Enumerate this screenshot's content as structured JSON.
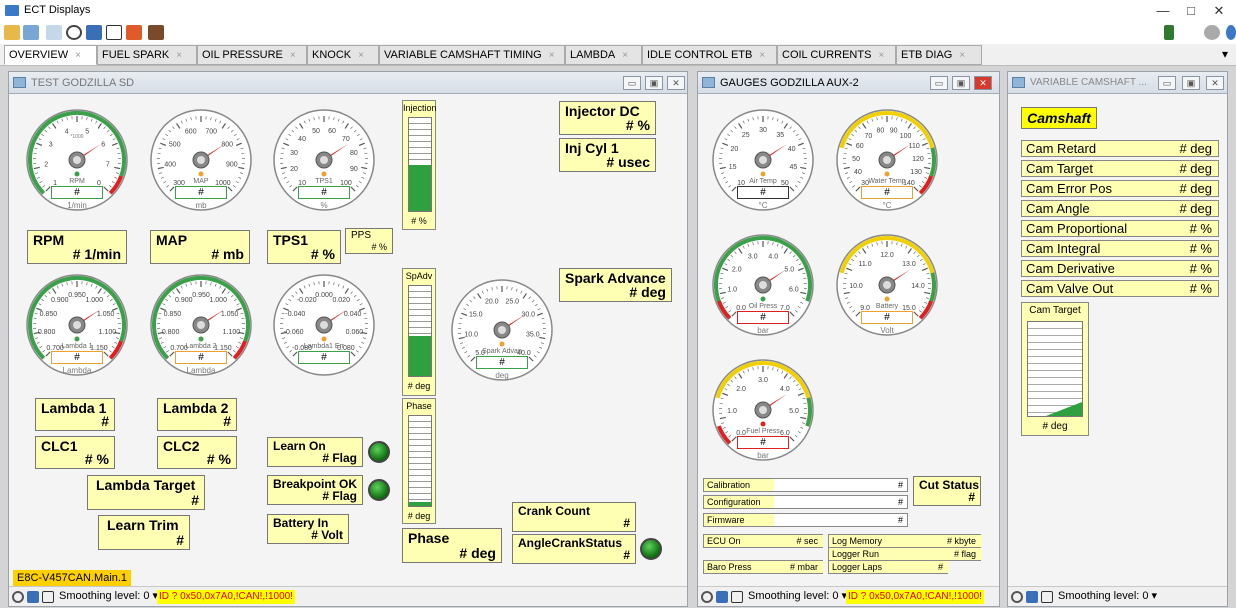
{
  "window": {
    "title": "ECT Displays",
    "min": "—",
    "max": "□",
    "close": "✕"
  },
  "toolbar": {
    "icons": [
      "open-folder-icon",
      "window-icon",
      "cursor-icon",
      "timer-icon",
      "book-icon",
      "export-icon",
      "lock-icon",
      "binoculars-icon"
    ],
    "right_icons": [
      "traffic-light-icon",
      "gear-icon",
      "help-icon"
    ]
  },
  "tabs": [
    {
      "label": "OVERVIEW",
      "x": "×"
    },
    {
      "label": "FUEL SPARK",
      "x": "×"
    },
    {
      "label": "OIL PRESSURE",
      "x": "×"
    },
    {
      "label": "KNOCK",
      "x": "×"
    },
    {
      "label": "VARIABLE CAMSHAFT TIMING",
      "x": "×"
    },
    {
      "label": "LAMBDA",
      "x": "×"
    },
    {
      "label": "IDLE CONTROL ETB",
      "x": "×"
    },
    {
      "label": "COIL CURRENTS",
      "x": "×"
    },
    {
      "label": "ETB DIAG",
      "x": "×"
    }
  ],
  "tab_dropdown": "▾",
  "panel1": {
    "title": "TEST GODZILLA SD",
    "gauges": [
      {
        "name": "RPM",
        "unit": "1/min",
        "value": "#",
        "ticks": [
          "1",
          "2",
          "3",
          "4",
          "5",
          "6",
          "7",
          "0"
        ],
        "mult": "*1000"
      },
      {
        "name": "MAP",
        "unit": "mb",
        "value": "#",
        "ticks": [
          "300",
          "400",
          "500",
          "600",
          "700",
          "800",
          "900",
          "1000"
        ]
      },
      {
        "name": "TPS1",
        "unit": "%",
        "value": "#",
        "ticks": [
          "10",
          "20",
          "30",
          "40",
          "50",
          "60",
          "70",
          "80",
          "90",
          "100"
        ]
      },
      {
        "name": "Lambda 1",
        "unit": "Lambda",
        "value": "#",
        "ticks": [
          "0.700",
          "0.800",
          "0.850",
          "0.900",
          "0.950",
          "1.000",
          "1.050",
          "1.100",
          "1.150"
        ]
      },
      {
        "name": "Lambda 2",
        "unit": "Lambda",
        "value": "#",
        "ticks": [
          "0.700",
          "0.800",
          "0.850",
          "0.900",
          "0.950",
          "1.000",
          "1.050",
          "1.100",
          "1.150"
        ]
      },
      {
        "name": "Lambda1 Err",
        "unit": "",
        "value": "#",
        "ticks": [
          "-0.080",
          "-0.060",
          "-0.040",
          "-0.020",
          "0.000",
          "0.020",
          "0.040",
          "0.060",
          "0.080"
        ]
      },
      {
        "name": "Spark Advan",
        "unit": "deg",
        "value": "#",
        "ticks": [
          "5.0",
          "10.0",
          "15.0",
          "20.0",
          "25.0",
          "30.0",
          "35.0",
          "40.0"
        ]
      }
    ],
    "boxes": {
      "injector_dc": {
        "title": "Injector DC",
        "value": "#  %"
      },
      "inj_cyl1": {
        "title": "Inj Cyl 1",
        "value": "#  usec"
      },
      "rpm": {
        "title": "RPM",
        "value": "#  1/min"
      },
      "map": {
        "title": "MAP",
        "value": "#   mb"
      },
      "tps1": {
        "title": "TPS1",
        "value": "#  %"
      },
      "pps": {
        "title": "PPS",
        "value": "#  %"
      },
      "spark_adv": {
        "title": "Spark Advance",
        "value": "#  deg"
      },
      "lambda1": {
        "title": "Lambda 1",
        "value": "#"
      },
      "lambda2": {
        "title": "Lambda 2",
        "value": "#"
      },
      "clc1": {
        "title": "CLC1",
        "value": "#  %"
      },
      "clc2": {
        "title": "CLC2",
        "value": "#  %"
      },
      "lambda_target": {
        "title": "Lambda Target",
        "value": "#"
      },
      "learn_trim": {
        "title": "Learn Trim",
        "value": "#"
      },
      "learn_on": {
        "title": "Learn On",
        "value": "#  Flag"
      },
      "breakpoint_ok": {
        "title": "Breakpoint OK",
        "value": "#  Flag"
      },
      "battery_in": {
        "title": "Battery In",
        "value": "#  Volt"
      },
      "crank_count": {
        "title": "Crank Count",
        "value": "#"
      },
      "phase": {
        "title": "Phase",
        "value": "#  deg"
      },
      "angle_crank": {
        "title": "AngleCrankStatus",
        "value": "#"
      }
    },
    "bars": [
      {
        "name": "Injection",
        "unit": "# %"
      },
      {
        "name": "SpAdv",
        "unit": "# deg"
      },
      {
        "name": "Phase",
        "unit": "# deg"
      }
    ],
    "footer_label": "E8C-V457CAN.Main.1",
    "status": "Smoothing level: 0 ▾",
    "warning": "ID ? 0x50,0x7A0,!CAN!,!1000!"
  },
  "panel2": {
    "title": "GAUGES GODZILLA AUX-2",
    "gauges": [
      {
        "name": "Air Temp",
        "unit": "°C",
        "value": "#",
        "ticks": [
          "10",
          "15",
          "20",
          "25",
          "30",
          "35",
          "40",
          "45",
          "50"
        ]
      },
      {
        "name": "Water Temp",
        "unit": "°C",
        "value": "#",
        "ticks": [
          "30",
          "40",
          "50",
          "60",
          "70",
          "80",
          "90",
          "100",
          "110",
          "120",
          "130",
          "140"
        ]
      },
      {
        "name": "Oil Press",
        "unit": "bar",
        "value": "#",
        "ticks": [
          "0.0",
          "1.0",
          "2.0",
          "3.0",
          "4.0",
          "5.0",
          "6.0",
          "7.0"
        ]
      },
      {
        "name": "Battery",
        "unit": "Volt",
        "value": "#",
        "ticks": [
          "9.0",
          "10.0",
          "11.0",
          "12.0",
          "13.0",
          "14.0",
          "15.0"
        ]
      },
      {
        "name": "Fuel Press",
        "unit": "bar",
        "value": "#",
        "ticks": [
          "0.0",
          "1.0",
          "2.0",
          "3.0",
          "4.0",
          "5.0",
          "6.0"
        ]
      }
    ],
    "info": {
      "calibration": {
        "label": "Calibration",
        "value": "#"
      },
      "configuration": {
        "label": "Configuration",
        "value": "#"
      },
      "firmware": {
        "label": "Firmware",
        "value": "#"
      },
      "cut_status": {
        "label": "Cut Status",
        "value": "#"
      },
      "ecu_on": {
        "label": "ECU On",
        "value": "#  sec"
      },
      "log_memory": {
        "label": "Log Memory",
        "value": "#   kbyte"
      },
      "logger_run": {
        "label": "Logger Run",
        "value": "#    flag"
      },
      "baro_press": {
        "label": "Baro Press",
        "value": "#  mbar"
      },
      "logger_laps": {
        "label": "Logger Laps",
        "value": "#"
      }
    },
    "status": "Smoothing level: 0 ▾",
    "warning": "ID ? 0x50,0x7A0,!CAN!,!1000!"
  },
  "panel3": {
    "title": "VARIABLE CAMSHAFT ...",
    "heading": "Camshaft",
    "rows": [
      {
        "label": "Cam Retard",
        "value": "#  deg"
      },
      {
        "label": "Cam Target",
        "value": "#  deg"
      },
      {
        "label": "Cam Error Pos",
        "value": "#  deg"
      },
      {
        "label": "Cam Angle",
        "value": "#  deg"
      },
      {
        "label": "Cam Proportional",
        "value": "#    %"
      },
      {
        "label": "Cam Integral",
        "value": "#    %"
      },
      {
        "label": "Cam Derivative",
        "value": "#    %"
      },
      {
        "label": "Cam Valve Out",
        "value": "#    %"
      }
    ],
    "bar": {
      "name": "Cam Target",
      "unit": "# deg"
    },
    "status": "Smoothing level: 0 ▾"
  }
}
